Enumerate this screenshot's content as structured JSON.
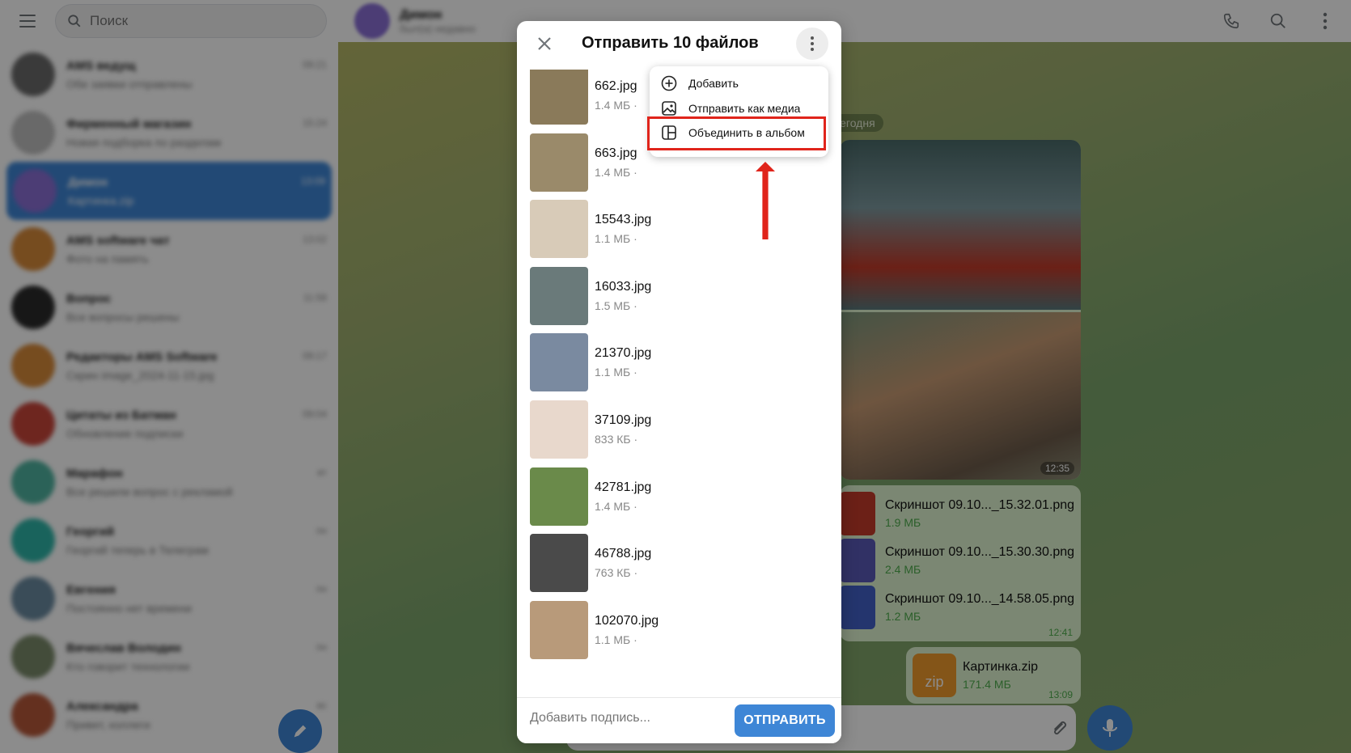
{
  "sidebar": {
    "search": {
      "placeholder": "Поиск"
    },
    "chats": [
      {
        "name": "AMS ведущ",
        "preview": "Обе заявки отправлены",
        "time": "09:21",
        "color": "#6a6a6a"
      },
      {
        "name": "Фирменный магазин",
        "preview": "Новая подборка по разделам",
        "time": "15:24",
        "color": "#bfbfbf"
      },
      {
        "name": "Димон",
        "preview": "Картинка.zip",
        "time": "13:09",
        "color": "#8a6fd6",
        "active": true
      },
      {
        "name": "AMS software чат",
        "preview": "Фото на память",
        "time": "13:02",
        "color": "#d88a3a"
      },
      {
        "name": "Вопрос",
        "preview": "Все вопросы решены",
        "time": "11:58",
        "color": "#2b2b2b"
      },
      {
        "name": "Редакторы AMS Software",
        "preview": "Скрин image_2024-11-15.jpg",
        "time": "09:17",
        "color": "#d88a3a"
      },
      {
        "name": "Цитаты из Батман",
        "preview": "Обновление подписки",
        "time": "09:04",
        "color": "#c9453a"
      },
      {
        "name": "Марафон",
        "preview": "Все решили вопрос с рекламой",
        "time": "вт",
        "color": "#4fb3a0"
      },
      {
        "name": "Георгий",
        "preview": "Георгий теперь в Телеграм",
        "time": "пн",
        "color": "#2fb5a8"
      },
      {
        "name": "Евгения",
        "preview": "Постоянно нет времени",
        "time": "пн",
        "color": "#6a8aa0"
      },
      {
        "name": "Вячеслав Володин",
        "preview": "Кто говорит технологии",
        "time": "пн",
        "color": "#7a8a6a"
      },
      {
        "name": "Александра",
        "preview": "Привет, коллеги",
        "time": "вс",
        "color": "#b6583a"
      }
    ]
  },
  "chat": {
    "title": "Димон",
    "subtitle": "был(а) недавно",
    "date_label": "Сегодня",
    "album_time": "12:35",
    "files": [
      {
        "name": "Скриншот 09.10..._15.32.01.png",
        "size": "1.9 МБ",
        "color": "#c53b2b"
      },
      {
        "name": "Скриншот 09.10..._15.30.30.png",
        "size": "2.4 МБ",
        "color": "#5a5ab8"
      },
      {
        "name": "Скриншот 09.10..._14.58.05.png",
        "size": "1.2 МБ",
        "color": "#4262c8"
      }
    ],
    "files_time": "12:41",
    "zip": {
      "icon": "zip",
      "name": "Картинка.zip",
      "size": "171.4 МБ",
      "time": "13:09"
    }
  },
  "modal": {
    "title": "Отправить 10 файлов",
    "items": [
      {
        "name": "662.jpg",
        "size": "1.4 МБ ·",
        "color": "#8a7a5a"
      },
      {
        "name": "663.jpg",
        "size": "1.4 МБ ·",
        "color": "#9a8a6a"
      },
      {
        "name": "15543.jpg",
        "size": "1.1 МБ ·",
        "color": "#d8cbb8"
      },
      {
        "name": "16033.jpg",
        "size": "1.5 МБ ·",
        "color": "#6a7a7a"
      },
      {
        "name": "21370.jpg",
        "size": "1.1 МБ ·",
        "color": "#7a8aa0"
      },
      {
        "name": "37109.jpg",
        "size": "833 КБ ·",
        "color": "#e8d8cc"
      },
      {
        "name": "42781.jpg",
        "size": "1.4 МБ ·",
        "color": "#6a8a4a"
      },
      {
        "name": "46788.jpg",
        "size": "763 КБ ·",
        "color": "#4a4a4a"
      },
      {
        "name": "102070.jpg",
        "size": "1.1 МБ ·",
        "color": "#b89a7a"
      }
    ],
    "caption_placeholder": "Добавить подпись...",
    "send_label": "ОТПРАВИТЬ"
  },
  "menu": {
    "add": "Добавить",
    "send_as_media": "Отправить как медиа",
    "group_album": "Объединить в альбом"
  },
  "colors": {
    "accent": "#3e86d6",
    "highlight": "#e0241b",
    "bubble": "#e1f6d2"
  }
}
